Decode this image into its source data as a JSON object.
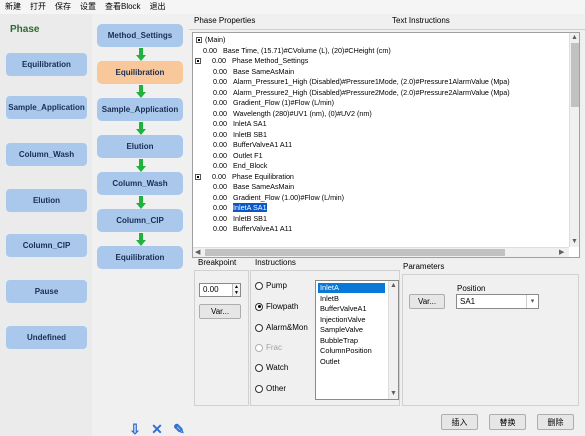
{
  "menubar": {
    "items": [
      "新建",
      "打开",
      "保存",
      "设置",
      "查看Block",
      "退出"
    ]
  },
  "phase_panel": {
    "title": "Phase",
    "items": [
      "Equilibration",
      "Sample_Application",
      "Column_Wash",
      "Elution",
      "Column_CIP",
      "Pause",
      "Undefined"
    ]
  },
  "method_flow": {
    "items": [
      "Method_Settings",
      "Equilibration",
      "Sample_Application",
      "Elution",
      "Column_Wash",
      "Column_CIP",
      "Equilibration"
    ],
    "selected_index": 1,
    "tools": [
      "⇩",
      "✕",
      "✎"
    ]
  },
  "tabs": {
    "phase_properties": "Phase Properties",
    "text_instructions": "Text Instructions"
  },
  "tree": {
    "lines": [
      {
        "num": "",
        "text": "(Main)",
        "expander": true,
        "indent": 0
      },
      {
        "num": "0.00",
        "text": "Base   Time,   (15.71)#CVolume (L),   (20)#CHeight (cm)",
        "indent": 1
      },
      {
        "num": "0.00",
        "text": "Phase   Method_Settings",
        "expander": true,
        "indent": 1
      },
      {
        "num": "0.00",
        "text": "Base   SameAsMain",
        "indent": 2
      },
      {
        "num": "0.00",
        "text": "Alarm_Pressure1_High   (Disabled)#Pressure1Mode,   (2.0)#Pressure1AlarmValue (Mpa)",
        "indent": 2
      },
      {
        "num": "0.00",
        "text": "Alarm_Pressure2_High   (Disabled)#Pressure2Mode,   (2.0)#Pressure2AlarmValue (Mpa)",
        "indent": 2
      },
      {
        "num": "0.00",
        "text": "Gradient_Flow   (1)#Flow (L/min)",
        "indent": 2
      },
      {
        "num": "0.00",
        "text": "Wavelength   (280)#UV1 (nm),   (0)#UV2 (nm)",
        "indent": 2
      },
      {
        "num": "0.00",
        "text": "InletA   SA1",
        "indent": 2
      },
      {
        "num": "0.00",
        "text": "InletB   SB1",
        "indent": 2
      },
      {
        "num": "0.00",
        "text": "BufferValveA1   A11",
        "indent": 2
      },
      {
        "num": "0.00",
        "text": "Outlet   F1",
        "indent": 2
      },
      {
        "num": "0.00",
        "text": "End_Block",
        "indent": 2
      },
      {
        "num": "0.00",
        "text": "Phase   Equilibration",
        "expander": true,
        "indent": 1
      },
      {
        "num": "0.00",
        "text": "Base   SameAsMain",
        "indent": 2
      },
      {
        "num": "0.00",
        "text": "Gradient_Flow   (1.00)#Flow (L/min)",
        "indent": 2
      },
      {
        "num": "0.00",
        "text": "InletA   SA1",
        "indent": 2,
        "selected": true
      },
      {
        "num": "0.00",
        "text": "InletB   SB1",
        "indent": 2
      },
      {
        "num": "0.00",
        "text": "BufferValveA1   A11",
        "indent": 2
      }
    ]
  },
  "editor": {
    "breakpoint_label": "Breakpoint",
    "breakpoint_value": "0.00",
    "instructions_label": "Instructions",
    "parameters_label": "Parameters",
    "var_button": "Var...",
    "var_button_2": "Var...",
    "position_label": "Position",
    "position_value": "SA1",
    "instruction_types": [
      {
        "label": "Pump",
        "checked": false,
        "disabled": false
      },
      {
        "label": "Flowpath",
        "checked": true,
        "disabled": false
      },
      {
        "label": "Alarm&Mon",
        "checked": false,
        "disabled": false
      },
      {
        "label": "Frac",
        "checked": false,
        "disabled": true
      },
      {
        "label": "Watch",
        "checked": false,
        "disabled": false
      },
      {
        "label": "Other",
        "checked": false,
        "disabled": false
      }
    ],
    "instruction_list": [
      "InletA",
      "InletB",
      "BufferValveA1",
      "InjectionValve",
      "SampleValve",
      "BubbleTrap",
      "ColumnPosition",
      "Outlet"
    ],
    "instruction_selected": 0,
    "insert_button": "插入",
    "replace_button": "替换",
    "delete_button": "删除"
  }
}
